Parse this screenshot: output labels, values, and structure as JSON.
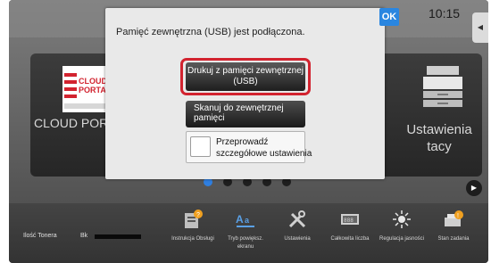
{
  "header": {
    "clock": "10:15"
  },
  "background_tiles": {
    "left_label": "CLOUD PORTAL",
    "logo_text_line1": "CLOUD",
    "logo_text_line2": "PORTAL",
    "right_label": "Ustawienia tacy"
  },
  "dialog": {
    "message": "Pamięć zewnętrzna (USB) jest podłączona.",
    "ok_label": "OK",
    "print_usb_label": "Drukuj z pamięci zewnętrznej (USB)",
    "scan_usb_label": "Skanuj do zewnętrznej pamięci",
    "detail_checkbox_checked": false,
    "detail_label": "Przeprowadź szczegółowe ustawienia"
  },
  "pager": {
    "pages": 5,
    "active_index": 0
  },
  "bottom_bar": {
    "toner_label": "Ilość Tonera",
    "toner_color_label": "Bk",
    "items": [
      {
        "label": "Instrukcja Obsługi",
        "icon": "manual-icon"
      },
      {
        "label": "Tryb powiększ. ekranu",
        "icon": "enlarge-icon"
      },
      {
        "label": "Ustawienia",
        "icon": "settings-tools-icon"
      },
      {
        "label": "Całkowita liczba",
        "icon": "counter-icon"
      },
      {
        "label": "Regulacja jasności",
        "icon": "brightness-icon"
      },
      {
        "label": "Stan zadania",
        "icon": "job-status-icon"
      }
    ]
  },
  "colors": {
    "accent_blue": "#2A86E0",
    "highlight_red": "#D2232F",
    "dialog_bg": "#E9E9E9"
  }
}
